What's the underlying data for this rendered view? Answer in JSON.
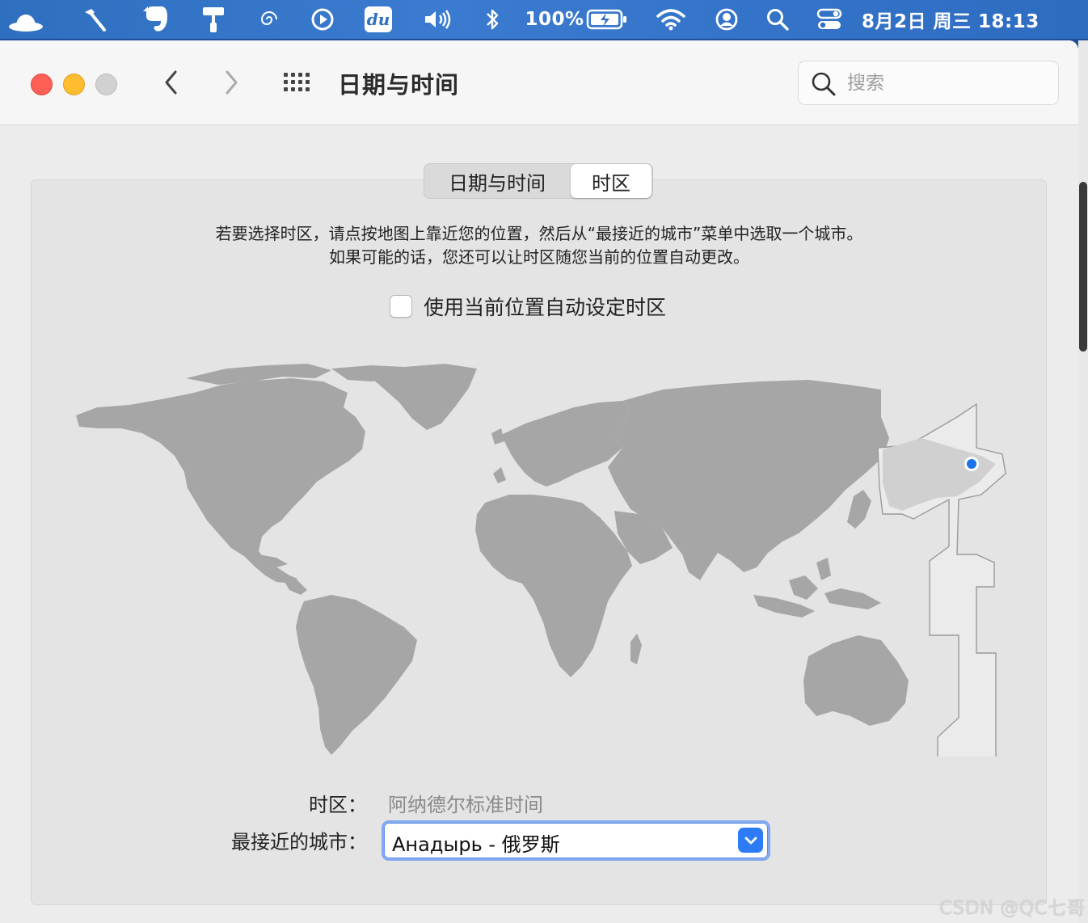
{
  "menubar": {
    "battery_percent": "100%",
    "datetime": "8月2日 周三  18:13",
    "items": [
      "hat-icon",
      "hammer-icon",
      "evernote-icon",
      "paint-roller-icon",
      "spiral-icon",
      "play-circle-icon",
      "du-icon",
      "volume-icon",
      "bluetooth-icon",
      "battery-icon",
      "wifi-icon",
      "user-circle-icon",
      "search-icon",
      "control-center-icon"
    ],
    "du_label": "du"
  },
  "toolbar": {
    "title": "日期与时间",
    "search_placeholder": "搜索"
  },
  "tabs": [
    {
      "label": "日期与时间",
      "selected": false
    },
    {
      "label": "时区",
      "selected": true
    }
  ],
  "instructions": {
    "line1": "若要选择时区，请点按地图上靠近您的位置，然后从“最接近的城市”菜单中选取一个城市。",
    "line2": "如果可能的话，您还可以让时区随您当前的位置自动更改。"
  },
  "auto_timezone": {
    "label": "使用当前位置自动设定时区",
    "checked": false
  },
  "timezone": {
    "label": "时区：",
    "value": "阿纳德尔标准时间"
  },
  "closest_city": {
    "label": "最接近的城市：",
    "value": "Анадырь - 俄罗斯"
  },
  "colors": {
    "accent": "#2d7cf6",
    "land": "#a6a6a6",
    "highlight_region": "#ebebeb",
    "location_pin": "#1a73e8"
  },
  "watermark": "CSDN @QC七哥"
}
